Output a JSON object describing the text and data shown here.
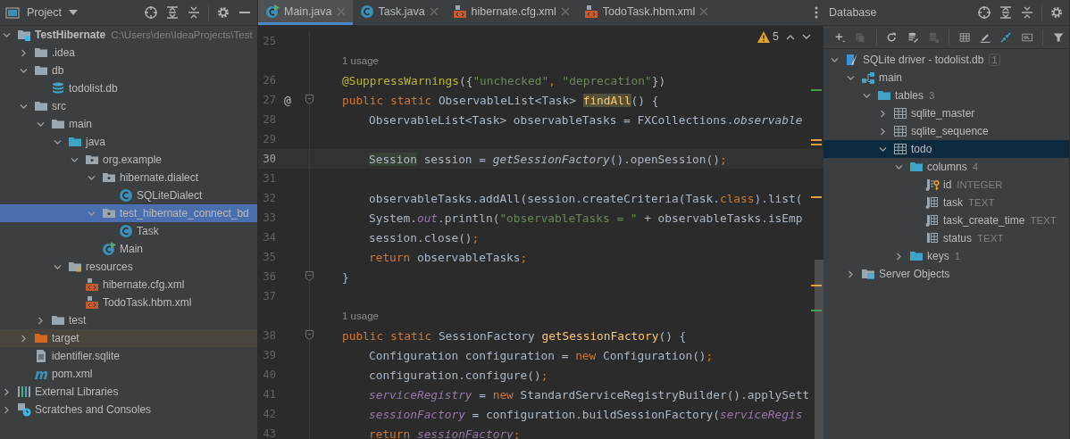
{
  "project_panel": {
    "title": "Project",
    "tree": [
      {
        "label": "TestHibernate",
        "hint": "C:\\Users\\den\\IdeaProjects\\Test",
        "kind": "module",
        "bold": true,
        "selected": false,
        "expanded": true,
        "children": [
          {
            "label": ".idea",
            "kind": "folder",
            "selected": false,
            "expanded": false
          },
          {
            "label": "db",
            "kind": "folder",
            "selected": false,
            "expanded": true,
            "children": [
              {
                "label": "todolist.db",
                "kind": "db",
                "selected": false
              }
            ]
          },
          {
            "label": "src",
            "kind": "folder",
            "selected": false,
            "expanded": true,
            "children": [
              {
                "label": "main",
                "kind": "folder",
                "selected": false,
                "expanded": true,
                "children": [
                  {
                    "label": "java",
                    "kind": "source",
                    "selected": false,
                    "expanded": true,
                    "children": [
                      {
                        "label": "org.example",
                        "kind": "package",
                        "selected": false,
                        "expanded": true,
                        "children": [
                          {
                            "label": "hibernate.dialect",
                            "kind": "package",
                            "selected": false,
                            "expanded": true,
                            "children": [
                              {
                                "label": "SQLiteDialect",
                                "kind": "class",
                                "selected": false
                              }
                            ]
                          },
                          {
                            "label": "test_hibernate_connect_bd",
                            "kind": "package",
                            "selected": true,
                            "expanded": true,
                            "children": [
                              {
                                "label": "Task",
                                "kind": "class",
                                "selected": false
                              }
                            ]
                          },
                          {
                            "label": "Main",
                            "kind": "main-class",
                            "selected": false
                          }
                        ]
                      }
                    ]
                  },
                  {
                    "label": "resources",
                    "kind": "resources",
                    "selected": false,
                    "expanded": true,
                    "children": [
                      {
                        "label": "hibernate.cfg.xml",
                        "kind": "xml",
                        "selected": false
                      },
                      {
                        "label": "TodoTask.hbm.xml",
                        "kind": "xml",
                        "selected": false
                      }
                    ]
                  }
                ]
              },
              {
                "label": "test",
                "kind": "folder",
                "selected": false,
                "expanded": false
              }
            ]
          },
          {
            "label": "target",
            "kind": "excluded",
            "selected": false,
            "highlighted": true,
            "expanded": false
          },
          {
            "label": "identifier.sqlite",
            "kind": "file",
            "selected": false
          },
          {
            "label": "pom.xml",
            "kind": "maven",
            "selected": false
          }
        ]
      },
      {
        "label": "External Libraries",
        "kind": "libraries",
        "selected": false,
        "expanded": false
      },
      {
        "label": "Scratches and Consoles",
        "kind": "scratches",
        "selected": false,
        "expanded": false
      }
    ]
  },
  "editor": {
    "tabs": [
      {
        "label": "Main.java",
        "kind": "main-class",
        "selected": true
      },
      {
        "label": "Task.java",
        "kind": "class",
        "selected": false
      },
      {
        "label": "hibernate.cfg.xml",
        "kind": "xml",
        "selected": false
      },
      {
        "label": "TodoTask.hbm.xml",
        "kind": "xml",
        "selected": false
      }
    ],
    "warnings": "5",
    "lines": [
      {
        "kind": "blank",
        "number": "25"
      },
      {
        "kind": "hint",
        "text": "1 usage"
      },
      {
        "kind": "member",
        "number": "26",
        "tokens": [
          {
            "text": "@SuppressWarnings",
            "kind": "annotation"
          },
          {
            "text": "({",
            "kind": "plain"
          },
          {
            "text": "\"unchecked\"",
            "kind": "string"
          },
          {
            "text": ", ",
            "kind": "keyword"
          },
          {
            "text": "\"deprecation\"",
            "kind": "string"
          },
          {
            "text": "})",
            "kind": "plain"
          }
        ]
      },
      {
        "kind": "member",
        "number": "27",
        "gutter": "@",
        "fold": true,
        "tokens": [
          {
            "text": "public static ",
            "kind": "keyword"
          },
          {
            "text": "ObservableList<Task> ",
            "kind": "plain"
          },
          {
            "text": "findAll",
            "kind": "method",
            "highlight": true
          },
          {
            "text": "() {",
            "kind": "plain"
          }
        ]
      },
      {
        "kind": "statement",
        "number": "28",
        "tokens": [
          {
            "text": "ObservableList<Task> observableTasks = FXCollections.",
            "kind": "plain"
          },
          {
            "text": "observable",
            "kind": "static"
          }
        ]
      },
      {
        "kind": "blank",
        "number": "29"
      },
      {
        "kind": "statement",
        "number": "30",
        "current": true,
        "tokens": [
          {
            "text": "Session",
            "kind": "plain",
            "highlight": true
          },
          {
            "text": " session = ",
            "kind": "plain"
          },
          {
            "text": "getSessionFactory",
            "kind": "static"
          },
          {
            "text": "().openSession()",
            "kind": "plain"
          },
          {
            "text": ";",
            "kind": "keyword"
          }
        ]
      },
      {
        "kind": "blank",
        "number": "31"
      },
      {
        "kind": "statement",
        "number": "32",
        "tokens": [
          {
            "text": "observableTasks.addAll(session.createCriteria(Task.",
            "kind": "plain"
          },
          {
            "text": "class",
            "kind": "keyword"
          },
          {
            "text": ").list(",
            "kind": "plain"
          }
        ]
      },
      {
        "kind": "statement",
        "number": "33",
        "tokens": [
          {
            "text": "System.",
            "kind": "plain"
          },
          {
            "text": "out",
            "kind": "field"
          },
          {
            "text": ".println(",
            "kind": "plain"
          },
          {
            "text": "\"observableTasks = \"",
            "kind": "string"
          },
          {
            "text": " + observableTasks.isEmp",
            "kind": "plain"
          }
        ]
      },
      {
        "kind": "statement",
        "number": "34",
        "tokens": [
          {
            "text": "session.close()",
            "kind": "plain"
          },
          {
            "text": ";",
            "kind": "keyword"
          }
        ]
      },
      {
        "kind": "statement",
        "number": "35",
        "tokens": [
          {
            "text": "return ",
            "kind": "keyword"
          },
          {
            "text": "observableTasks",
            "kind": "plain"
          },
          {
            "text": ";",
            "kind": "keyword"
          }
        ]
      },
      {
        "kind": "member",
        "number": "36",
        "fold": true,
        "tokens": [
          {
            "text": "}",
            "kind": "plain"
          }
        ]
      },
      {
        "kind": "blank",
        "number": "37"
      },
      {
        "kind": "hint",
        "text": "1 usage"
      },
      {
        "kind": "member",
        "number": "38",
        "fold": true,
        "tokens": [
          {
            "text": "public static ",
            "kind": "keyword"
          },
          {
            "text": "SessionFactory ",
            "kind": "plain"
          },
          {
            "text": "getSessionFactory",
            "kind": "method"
          },
          {
            "text": "() {",
            "kind": "plain"
          }
        ]
      },
      {
        "kind": "statement",
        "number": "39",
        "tokens": [
          {
            "text": "Configuration configuration = ",
            "kind": "plain"
          },
          {
            "text": "new ",
            "kind": "keyword"
          },
          {
            "text": "Configuration()",
            "kind": "plain"
          },
          {
            "text": ";",
            "kind": "keyword"
          }
        ]
      },
      {
        "kind": "statement",
        "number": "40",
        "tokens": [
          {
            "text": "configuration.configure()",
            "kind": "plain"
          },
          {
            "text": ";",
            "kind": "keyword"
          }
        ]
      },
      {
        "kind": "statement",
        "number": "41",
        "tokens": [
          {
            "text": "serviceRegistry",
            "kind": "field"
          },
          {
            "text": " = ",
            "kind": "plain"
          },
          {
            "text": "new ",
            "kind": "keyword"
          },
          {
            "text": "StandardServiceRegistryBuilder().applySett",
            "kind": "plain"
          }
        ]
      },
      {
        "kind": "statement",
        "number": "42",
        "tokens": [
          {
            "text": "sessionFactory",
            "kind": "field"
          },
          {
            "text": " = configuration.buildSessionFactory(",
            "kind": "plain"
          },
          {
            "text": "serviceRegis",
            "kind": "field"
          }
        ]
      },
      {
        "kind": "statement",
        "number": "43",
        "tokens": [
          {
            "text": "return ",
            "kind": "keyword"
          },
          {
            "text": "sessionFactory",
            "kind": "field"
          },
          {
            "text": ";",
            "kind": "keyword"
          }
        ]
      }
    ]
  },
  "database_panel": {
    "title": "Database",
    "tree": [
      {
        "label": "SQLite driver - todolist.db",
        "badge": "1",
        "kind": "datasource",
        "selected": false,
        "expanded": true,
        "children": [
          {
            "label": "main",
            "kind": "schema",
            "selected": false,
            "expanded": true,
            "children": [
              {
                "label": "tables",
                "hint": "3",
                "kind": "source",
                "selected": false,
                "expanded": true,
                "children": [
                  {
                    "label": "sqlite_master",
                    "kind": "table",
                    "selected": false,
                    "expanded": false
                  },
                  {
                    "label": "sqlite_sequence",
                    "kind": "table",
                    "selected": false,
                    "expanded": false
                  },
                  {
                    "label": "todo",
                    "kind": "table",
                    "selected": true,
                    "expanded": true,
                    "children": [
                      {
                        "label": "columns",
                        "hint": "4",
                        "kind": "source",
                        "selected": false,
                        "expanded": true,
                        "children": [
                          {
                            "label": "id",
                            "hint": "INTEGER",
                            "kind": "key-column",
                            "selected": false
                          },
                          {
                            "label": "task",
                            "hint": "TEXT",
                            "kind": "notnull-column",
                            "selected": false
                          },
                          {
                            "label": "task_create_time",
                            "hint": "TEXT",
                            "kind": "notnull-column",
                            "selected": false
                          },
                          {
                            "label": "status",
                            "hint": "TEXT",
                            "kind": "column",
                            "selected": false
                          }
                        ]
                      },
                      {
                        "label": "keys",
                        "hint": "1",
                        "kind": "source",
                        "selected": false,
                        "expanded": false
                      }
                    ]
                  }
                ]
              }
            ]
          },
          {
            "label": "Server Objects",
            "kind": "server",
            "selected": false,
            "expanded": false
          }
        ]
      }
    ]
  }
}
